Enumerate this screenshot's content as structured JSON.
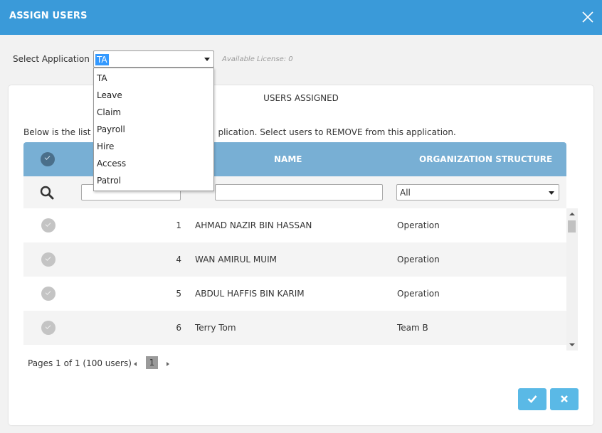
{
  "header": {
    "title": "ASSIGN USERS",
    "close_icon": "close-icon"
  },
  "application": {
    "label": "Select Application",
    "selected": "TA",
    "available_license": "Available License: 0",
    "options": [
      "TA",
      "Leave",
      "Claim",
      "Payroll",
      "Hire",
      "Access",
      "Patrol"
    ]
  },
  "card": {
    "title": "USERS ASSIGNED",
    "description": "Below is the list of users assigned to this application. Select users to REMOVE from this application.",
    "description_visible_left": "Below is the list",
    "description_visible_right": "plication. Select users to REMOVE from this application."
  },
  "table": {
    "columns": {
      "name": "NAME",
      "org": "ORGANIZATION STRUCTURE"
    },
    "filter": {
      "id_value": "",
      "name_value": "",
      "org_value": "All"
    },
    "rows": [
      {
        "num": "1",
        "name": "AHMAD NAZIR BIN HASSAN",
        "org": "Operation"
      },
      {
        "num": "4",
        "name": "WAN AMIRUL MUIM",
        "org": "Operation"
      },
      {
        "num": "5",
        "name": "ABDUL HAFFIS BIN KARIM",
        "org": "Operation"
      },
      {
        "num": "6",
        "name": "Terry Tom",
        "org": "Team B"
      }
    ]
  },
  "pager": {
    "summary": "Pages 1 of 1 (100 users)",
    "current_page": "1"
  },
  "colors": {
    "header": "#3a9ad9",
    "table_header": "#78afd4",
    "button": "#5ab9e6"
  }
}
